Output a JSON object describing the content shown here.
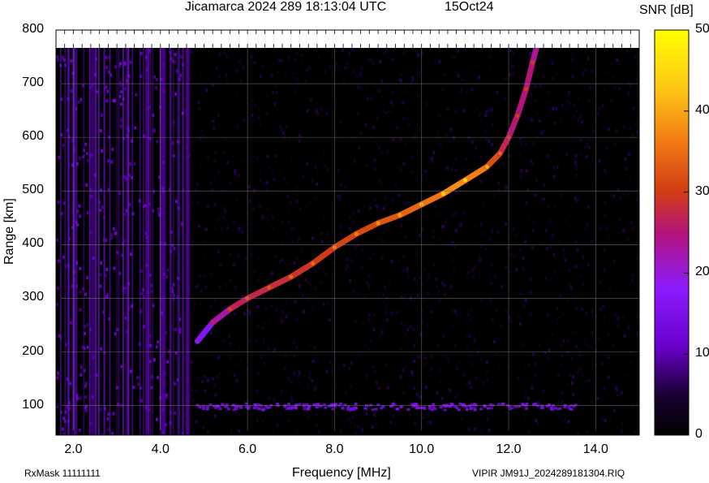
{
  "header": {
    "title": "Jicamarca 2024 289 18:13:04 UTC",
    "date": "15Oct24"
  },
  "footer": {
    "left": "RxMask 11111111",
    "right": "VIPIR  JM91J_2024289181304.RIQ"
  },
  "chart_data": {
    "type": "heatmap",
    "title": "Jicamarca 2024 289 18:13:04 UTC",
    "xlabel": "Frequency [MHz]",
    "ylabel": "Range [km]",
    "xlim": [
      1.6,
      15.0
    ],
    "ylim": [
      45,
      800
    ],
    "xticks": [
      "2.0",
      "4.0",
      "6.0",
      "8.0",
      "10.0",
      "12.0",
      "14.0"
    ],
    "xtick_values": [
      2,
      4,
      6,
      8,
      10,
      12,
      14
    ],
    "yticks": [
      "100",
      "200",
      "300",
      "400",
      "500",
      "600",
      "700",
      "800"
    ],
    "ytick_values": [
      100,
      200,
      300,
      400,
      500,
      600,
      700,
      800
    ],
    "grid": true,
    "colorbar": {
      "label": "SNR [dB]",
      "range": [
        0,
        50
      ],
      "ticks": [
        "0",
        "10",
        "20",
        "30",
        "40",
        "50"
      ],
      "tick_values": [
        0,
        10,
        20,
        30,
        40,
        50
      ],
      "colors": [
        "#000000",
        "#1a0033",
        "#6a00cc",
        "#8c1aff",
        "#b4147a",
        "#d23c14",
        "#f07814",
        "#ffc814",
        "#ffff00"
      ]
    },
    "echo_trace": {
      "frequency_mhz": [
        4.85,
        5.2,
        5.6,
        6.0,
        6.5,
        7.0,
        7.5,
        8.0,
        8.5,
        9.0,
        9.5,
        10.0,
        10.5,
        11.0,
        11.5,
        11.8,
        12.0,
        12.2,
        12.4,
        12.55,
        12.65
      ],
      "range_km": [
        220,
        255,
        280,
        300,
        320,
        340,
        365,
        395,
        420,
        440,
        455,
        475,
        495,
        520,
        545,
        570,
        600,
        640,
        690,
        740,
        770
      ],
      "snr_db": [
        15,
        20,
        26,
        28,
        28,
        30,
        30,
        32,
        32,
        33,
        35,
        36,
        38,
        40,
        36,
        30,
        26,
        25,
        25,
        25,
        22
      ]
    },
    "sporadic_layer": {
      "range_km": 100,
      "frequency_mhz": [
        4.8,
        13.5
      ],
      "snr_db": 14
    }
  }
}
